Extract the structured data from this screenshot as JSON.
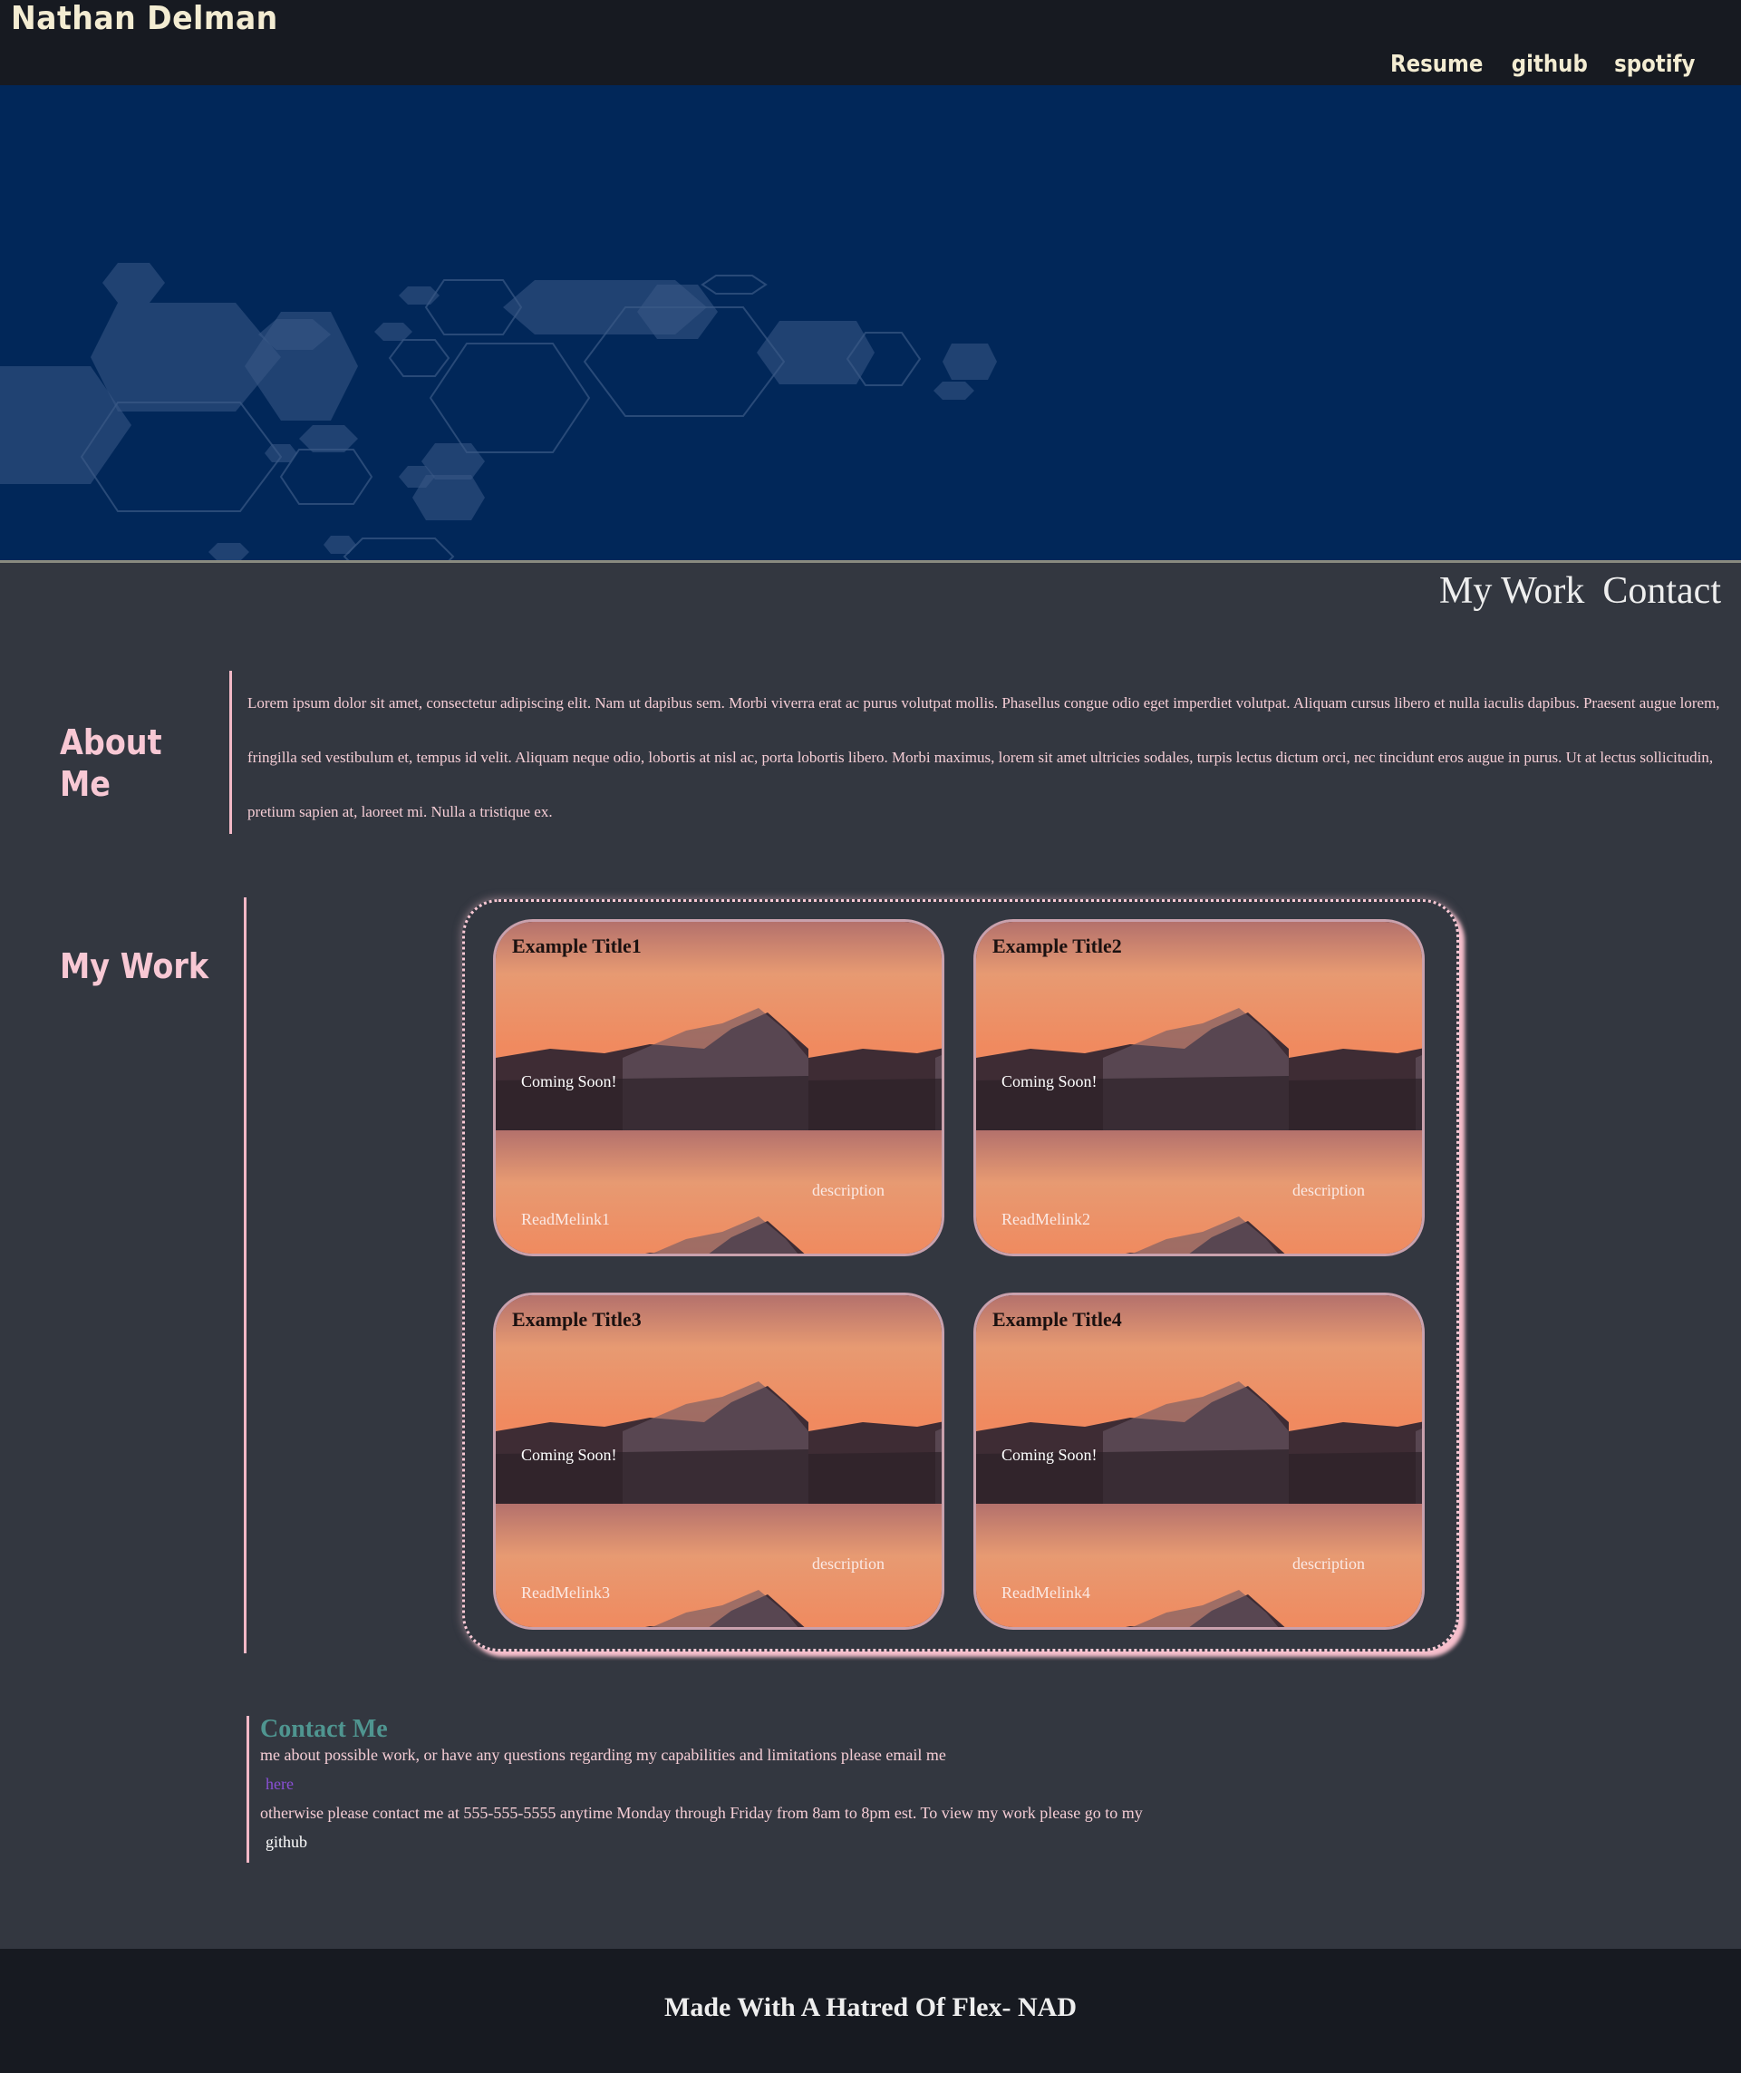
{
  "header": {
    "site_name": "Nathan Delman",
    "nav": [
      "Resume",
      "github",
      "spotify"
    ]
  },
  "section_nav": [
    "My Work",
    "Contact"
  ],
  "about": {
    "heading": "About Me",
    "text": "Lorem ipsum dolor sit amet, consectetur adipiscing elit. Nam ut dapibus sem. Morbi viverra erat ac purus volutpat mollis. Phasellus congue odio eget imperdiet volutpat. Aliquam cursus libero et nulla iaculis dapibus. Praesent augue lorem, fringilla sed vestibulum et, tempus id velit. Aliquam neque odio, lobortis at nisl ac, porta lobortis libero. Morbi maximus, lorem sit amet ultricies sodales, turpis lectus dictum orci, nec tincidunt eros augue in purus. Ut at lectus sollicitudin, pretium sapien at, laoreet mi. Nulla a tristique ex."
  },
  "work": {
    "heading": "My Work",
    "cards": [
      {
        "title": "Example Title1",
        "status": "Coming Soon!",
        "description": "description",
        "link": "ReadMelink1"
      },
      {
        "title": "Example Title2",
        "status": "Coming Soon!",
        "description": "description",
        "link": "ReadMelink2"
      },
      {
        "title": "Example Title3",
        "status": "Coming Soon!",
        "description": "description",
        "link": "ReadMelink3"
      },
      {
        "title": "Example Title4",
        "status": "Coming Soon!",
        "description": "description",
        "link": "ReadMelink4"
      }
    ]
  },
  "contact": {
    "heading": "Contact Me",
    "line1": "me about possible work, or have any questions regarding my capabilities and limitations please email me",
    "email_link": "here",
    "line2": "otherwise please contact me at 555-555-5555 anytime Monday through Friday from 8am to 8pm est. To view my work please go to my",
    "github_link": "github"
  },
  "footer": {
    "text": "Made With A Hatred Of Flex- NAD"
  },
  "colors": {
    "header_bg": "#171a21",
    "hero_bg": "#012759",
    "page_bg": "#333740",
    "accent_pink": "#f8c8d4",
    "contact_heading": "#4f9590",
    "email_link": "#8a4fd6"
  }
}
